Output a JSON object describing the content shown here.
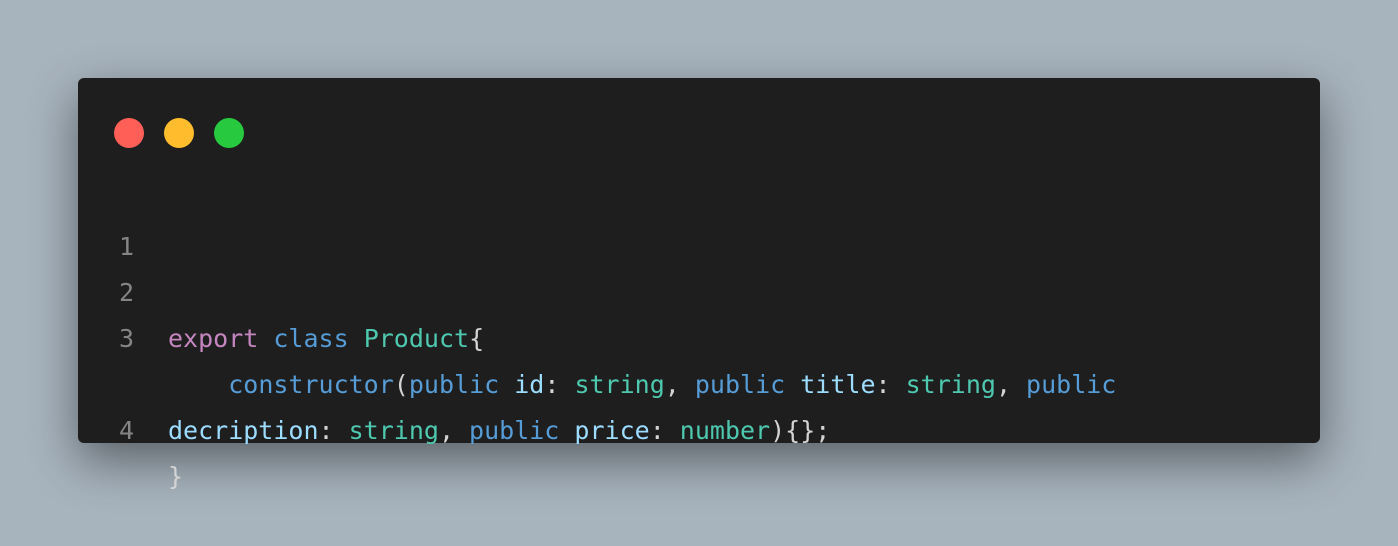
{
  "window": {
    "controls": [
      {
        "name": "close",
        "color": "#ff5f56"
      },
      {
        "name": "minimize",
        "color": "#ffbd2e"
      },
      {
        "name": "maximize",
        "color": "#27c93f"
      }
    ]
  },
  "code": {
    "lines": [
      {
        "number": "1",
        "tokens": []
      },
      {
        "number": "2",
        "tokens": [
          {
            "text": "export",
            "kind": "kw"
          },
          {
            "text": " ",
            "kind": "punc"
          },
          {
            "text": "class",
            "kind": "kw2"
          },
          {
            "text": " ",
            "kind": "punc"
          },
          {
            "text": "Product",
            "kind": "type"
          },
          {
            "text": "{",
            "kind": "punc"
          }
        ]
      },
      {
        "number": "3",
        "tokens": [
          {
            "text": "    ",
            "kind": "punc"
          },
          {
            "text": "constructor",
            "kind": "fn"
          },
          {
            "text": "(",
            "kind": "punc"
          },
          {
            "text": "public",
            "kind": "kw2"
          },
          {
            "text": " ",
            "kind": "punc"
          },
          {
            "text": "id",
            "kind": "prop"
          },
          {
            "text": ": ",
            "kind": "punc"
          },
          {
            "text": "string",
            "kind": "type"
          },
          {
            "text": ", ",
            "kind": "punc"
          },
          {
            "text": "public",
            "kind": "kw2"
          },
          {
            "text": " ",
            "kind": "punc"
          },
          {
            "text": "title",
            "kind": "prop"
          },
          {
            "text": ": ",
            "kind": "punc"
          },
          {
            "text": "string",
            "kind": "type"
          },
          {
            "text": ", ",
            "kind": "punc"
          },
          {
            "text": "public",
            "kind": "kw2"
          }
        ]
      },
      {
        "number": "",
        "tokens": [
          {
            "text": "decription",
            "kind": "prop"
          },
          {
            "text": ": ",
            "kind": "punc"
          },
          {
            "text": "string",
            "kind": "type"
          },
          {
            "text": ", ",
            "kind": "punc"
          },
          {
            "text": "public",
            "kind": "kw2"
          },
          {
            "text": " ",
            "kind": "punc"
          },
          {
            "text": "price",
            "kind": "prop"
          },
          {
            "text": ": ",
            "kind": "punc"
          },
          {
            "text": "number",
            "kind": "type"
          },
          {
            "text": "){};",
            "kind": "punc"
          }
        ]
      },
      {
        "number": "4",
        "tokens": [
          {
            "text": "}",
            "kind": "punc"
          }
        ]
      }
    ]
  }
}
